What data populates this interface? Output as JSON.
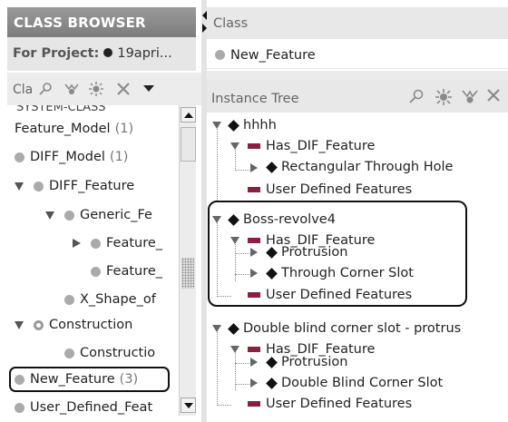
{
  "left_panel": {
    "title": "CLASS BROWSER",
    "project_label": "For Project:",
    "project_name": "19apri...",
    "toolbar_label": "Cla",
    "cut_row_text": "SYSTEM-CLASS",
    "items": [
      {
        "label": "Feature_Model",
        "count": "(1)"
      },
      {
        "label": "DIFF_Model",
        "count": "(1)"
      },
      {
        "label": "DIFF_Feature",
        "count": ""
      },
      {
        "label": "Generic_Fe",
        "count": ""
      },
      {
        "label": "Feature_",
        "count": ""
      },
      {
        "label": "Feature_",
        "count": ""
      },
      {
        "label": "X_Shape_of",
        "count": ""
      },
      {
        "label": "Construction",
        "count": ""
      },
      {
        "label": "Constructio",
        "count": ""
      },
      {
        "label": "New_Feature",
        "count": "(3)"
      },
      {
        "label": "User_Defined_Feat",
        "count": ""
      }
    ]
  },
  "right_panel": {
    "class_header": "Class",
    "class_value": "New_Feature",
    "tree_header": "Instance Tree",
    "tree": [
      {
        "label": "hhhh"
      },
      {
        "label": "Has_DIF_Feature"
      },
      {
        "label": "Rectangular Through Hole"
      },
      {
        "label": "User Defined Features"
      },
      {
        "label": "Boss-revolve4"
      },
      {
        "label": "Has_DIF_Feature"
      },
      {
        "label": "Protrusion"
      },
      {
        "label": "Through Corner Slot"
      },
      {
        "label": "User Defined Features"
      },
      {
        "label": "Double blind corner slot - protrus"
      },
      {
        "label": "Has_DIF_Feature"
      },
      {
        "label": "Protrusion"
      },
      {
        "label": "Double Blind Corner Slot"
      },
      {
        "label": "User Defined Features"
      }
    ]
  },
  "colors": {
    "header_gradient": "#8a8a8a",
    "relation_bar": "#8a1f3e",
    "class_dot": "#aaaaaa"
  }
}
